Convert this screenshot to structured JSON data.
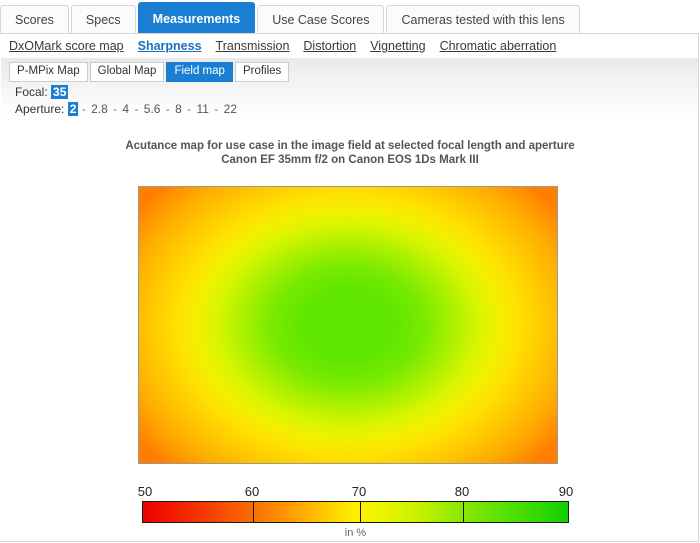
{
  "tabs": [
    {
      "label": "Scores",
      "active": false
    },
    {
      "label": "Specs",
      "active": false
    },
    {
      "label": "Measurements",
      "active": true
    },
    {
      "label": "Use Case Scores",
      "active": false
    },
    {
      "label": "Cameras tested with this lens",
      "active": false
    }
  ],
  "subnav": [
    {
      "label": "DxOMark score map",
      "active": false
    },
    {
      "label": "Sharpness",
      "active": true
    },
    {
      "label": "Transmission",
      "active": false
    },
    {
      "label": "Distortion",
      "active": false
    },
    {
      "label": "Vignetting",
      "active": false
    },
    {
      "label": "Chromatic aberration",
      "active": false
    }
  ],
  "view_tabs": [
    {
      "label": "P-MPix Map",
      "active": false
    },
    {
      "label": "Global Map",
      "active": false
    },
    {
      "label": "Field map",
      "active": true
    },
    {
      "label": "Profiles",
      "active": false
    }
  ],
  "params": {
    "focal_label": "Focal:",
    "focal_values": [
      "35"
    ],
    "focal_selected": "35",
    "aperture_label": "Aperture:",
    "aperture_values": [
      "2",
      "2.8",
      "4",
      "5.6",
      "8",
      "11",
      "22"
    ],
    "aperture_selected": "2"
  },
  "chart_data": {
    "type": "heatmap",
    "title": "Acutance map for use case in the image field at selected focal length and aperture",
    "subtitle": "Canon EF 35mm f/2 on Canon EOS 1Ds Mark III",
    "unit_label": "in %",
    "colorbar": {
      "min": 50,
      "max": 90,
      "ticks": [
        50,
        60,
        70,
        80,
        90
      ],
      "tick_labels": [
        "50",
        "60",
        "70",
        "80",
        "90"
      ],
      "stops": [
        {
          "value": 50,
          "color": "#ee0000"
        },
        {
          "value": 60,
          "color": "#ffa400"
        },
        {
          "value": 70,
          "color": "#fff000"
        },
        {
          "value": 80,
          "color": "#8ae800"
        },
        {
          "value": 90,
          "color": "#11d000"
        }
      ]
    },
    "field_values": {
      "center": 83,
      "mid_radius": 74,
      "edge": 68,
      "corner": 63
    },
    "grid": false,
    "legend_position": "bottom"
  },
  "colors": {
    "accent_blue": "#1a7fd3",
    "link": "#3a3a3a",
    "active_link": "#1a6fbf",
    "panel_border": "#d6d6d6"
  }
}
